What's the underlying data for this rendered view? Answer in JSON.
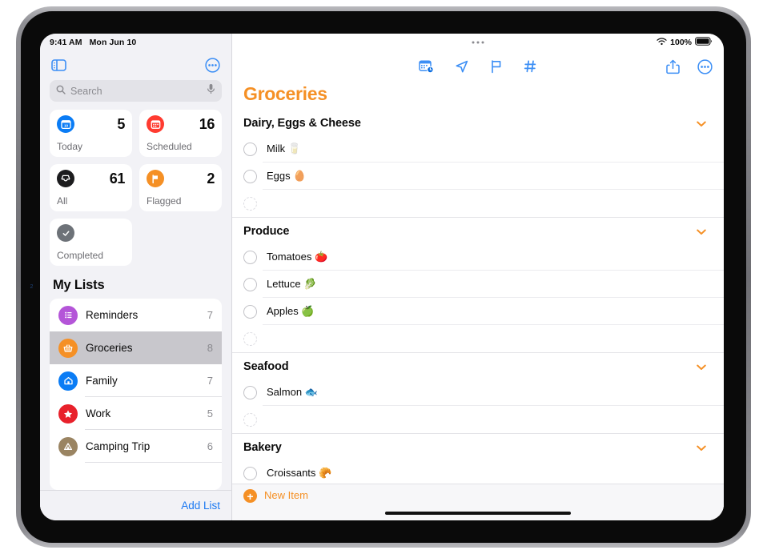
{
  "status_bar": {
    "time": "9:41 AM",
    "date": "Mon Jun 10",
    "battery_percent": "100%",
    "wifi_icon": "wifi-icon",
    "battery_icon": "battery-full-icon"
  },
  "sidebar": {
    "toggle_icon": "sidebar-toggle-icon",
    "more_icon": "more-circle-icon",
    "search": {
      "placeholder": "Search",
      "value": "",
      "search_icon": "search-icon",
      "mic_icon": "microphone-icon"
    },
    "smart_lists": [
      {
        "label": "Today",
        "count": "5",
        "icon": "calendar-day-icon",
        "color": "#0a7cf5",
        "glyph": "10"
      },
      {
        "label": "Scheduled",
        "count": "16",
        "icon": "calendar-icon",
        "color": "#ff3b30",
        "glyph": "▦"
      },
      {
        "label": "All",
        "count": "61",
        "icon": "inbox-icon",
        "color": "#1c1c1e",
        "glyph": "▤"
      },
      {
        "label": "Flagged",
        "count": "2",
        "icon": "flag-icon",
        "color": "#f59025",
        "glyph": "⚑"
      },
      {
        "label": "Completed",
        "count": "",
        "icon": "checkmark-icon",
        "color": "#6d7278",
        "glyph": "✓"
      }
    ],
    "my_lists_title": "My Lists",
    "lists": [
      {
        "name": "Reminders",
        "count": "7",
        "icon": "bullet-list-icon",
        "color": "#b455d8",
        "glyph": "☰",
        "selected": false
      },
      {
        "name": "Groceries",
        "count": "8",
        "icon": "basket-icon",
        "color": "#f59025",
        "glyph": "🧺",
        "selected": true
      },
      {
        "name": "Family",
        "count": "7",
        "icon": "house-icon",
        "color": "#0a7cf5",
        "glyph": "⌂",
        "selected": false
      },
      {
        "name": "Work",
        "count": "5",
        "icon": "star-icon",
        "color": "#e8212b",
        "glyph": "★",
        "selected": false
      },
      {
        "name": "Camping Trip",
        "count": "6",
        "icon": "tent-icon",
        "color": "#9a8462",
        "glyph": "⛰",
        "selected": false
      }
    ],
    "add_list_label": "Add List"
  },
  "main": {
    "multitask_icon": "multitasking-dots-icon",
    "toolbar_icons": [
      {
        "name": "calendar-clock-icon",
        "glyph": "📅"
      },
      {
        "name": "location-arrow-icon",
        "glyph": "➤"
      },
      {
        "name": "flag-outline-icon",
        "glyph": "⚑"
      },
      {
        "name": "hashtag-icon",
        "glyph": "#"
      }
    ],
    "share_icon": "share-icon",
    "more_icon": "more-circle-icon",
    "title": "Groceries",
    "sections": [
      {
        "title": "Dairy, Eggs & Cheese",
        "chevron": "chevron-down-icon",
        "items": [
          {
            "text": "Milk 🥛"
          },
          {
            "text": "Eggs 🥚"
          }
        ]
      },
      {
        "title": "Produce",
        "chevron": "chevron-down-icon",
        "items": [
          {
            "text": "Tomatoes 🍅"
          },
          {
            "text": "Lettuce 🥬"
          },
          {
            "text": "Apples 🍏"
          }
        ]
      },
      {
        "title": "Seafood",
        "chevron": "chevron-down-icon",
        "items": [
          {
            "text": "Salmon 🐟"
          }
        ]
      },
      {
        "title": "Bakery",
        "chevron": "chevron-down-icon",
        "items": [
          {
            "text": "Croissants 🥐"
          }
        ]
      }
    ],
    "new_item_label": "New Item",
    "new_item_icon": "plus-circle-icon"
  }
}
